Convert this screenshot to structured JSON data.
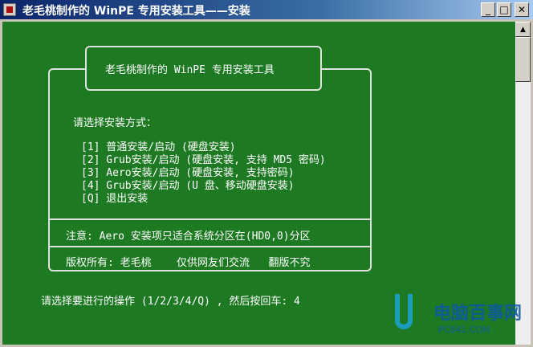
{
  "window": {
    "title": "老毛桃制作的 WinPE 专用安装工具——安装",
    "buttons": {
      "minimize": "_",
      "maximize": "□",
      "close": "✕"
    }
  },
  "console": {
    "header": "老毛桃制作的 WinPE 专用安装工具",
    "prompt_heading": "请选择安装方式：",
    "options": [
      "[1] 普通安装/启动 (硬盘安装)",
      "[2] Grub安装/启动 (硬盘安装, 支持 MD5 密码)",
      "[3] Aero安装/启动 (硬盘安装, 支持密码)",
      "[4] Grub安装/启动 (U 盘、移动硬盘安装)",
      "[Q] 退出安装"
    ],
    "note": "注意: Aero 安装项只适合系统分区在(HD0,0)分区",
    "copyright": "版权所有: 老毛桃    仅供网友们交流   翻版不究",
    "input_prompt": "请选择要进行的操作 (1/2/3/4/Q) , 然后按回车: 4"
  },
  "scrollbar": {
    "up": "▲"
  },
  "watermark": {
    "text": "电脑百事网",
    "sub": "PC841.COM"
  },
  "colors": {
    "console_bg": "#1d7a22",
    "console_fg": "#ffffff",
    "titlebar": "#0a246a"
  }
}
